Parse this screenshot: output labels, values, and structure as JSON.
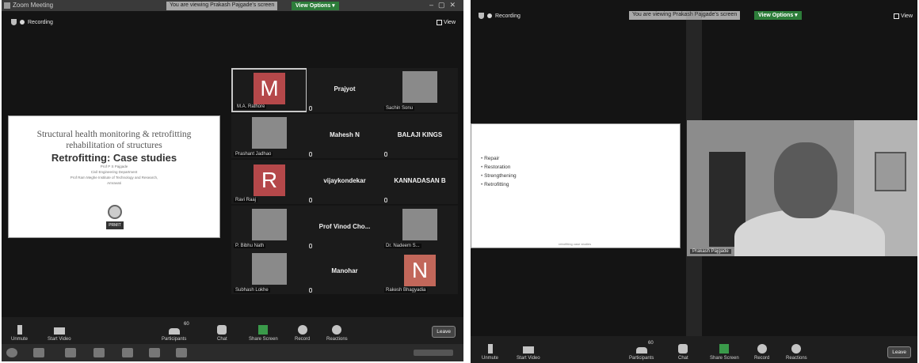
{
  "left": {
    "window_title": "Zoom Meeting",
    "share_banner": "You are viewing Prakash Pajgade's screen",
    "view_options": "View Options ▾",
    "recording": "Recording",
    "view_label": "View",
    "slide": {
      "title_line1": "Structural health monitoring & retrofitting",
      "title_line2": "rehabilitation of structures",
      "title_main": "Retrofitting: Case studies",
      "line_author": "Prof P S Pajgade",
      "line_dept": "Civil Engineering Department",
      "line_inst": "Prof Ram Meghe Institute of Technology and Research,",
      "line_city": "Amravati",
      "logo_text": "PRMIT"
    },
    "tiles": [
      {
        "name": "M.A. Rathore",
        "letter": "M",
        "color": "#b5484a"
      },
      {
        "center_name": "Prajyot"
      },
      {
        "name": "Sachin Sonu"
      },
      {
        "name": "Prashant Jadhao"
      },
      {
        "center_name": "Mahesh N"
      },
      {
        "center_name": "BALAJI KINGS"
      },
      {
        "name": "Ravi Raaj",
        "letter": "R",
        "color": "#b5484a"
      },
      {
        "center_name": "vijaykondekar"
      },
      {
        "center_name": "KANNADASAN B"
      },
      {
        "name": "P. Bibhu Nath"
      },
      {
        "center_name": "Prof Vinod Cho..."
      },
      {
        "name": "Dr. Nadeem S..."
      },
      {
        "name": "Subhash Lokhe"
      },
      {
        "center_name": "Manohar"
      },
      {
        "name": "Rakesh Bhagyadia",
        "letter": "N",
        "color": "#c2675a"
      }
    ],
    "toolbar": {
      "unmute": "Unmute",
      "start_video": "Start Video",
      "participants": "Participants",
      "participants_count": "60",
      "chat": "Chat",
      "share_screen": "Share Screen",
      "record": "Record",
      "reactions": "Reactions",
      "leave": "Leave"
    }
  },
  "right": {
    "recording": "Recording",
    "share_banner": "You are viewing Prakash Pajgade's screen",
    "view_options": "View Options ▾",
    "view_label": "View",
    "bullets": [
      "Repair",
      "Restoration",
      "Strengthening",
      "Retrofitting"
    ],
    "slide_footer": "retrofitting case studies",
    "camera_name": "Prakash Pajgade",
    "toolbar": {
      "unmute": "Unmute",
      "start_video": "Start Video",
      "participants": "Participants",
      "participants_count": "60",
      "chat": "Chat",
      "share_screen": "Share Screen",
      "record": "Record",
      "reactions": "Reactions",
      "leave": "Leave"
    }
  }
}
